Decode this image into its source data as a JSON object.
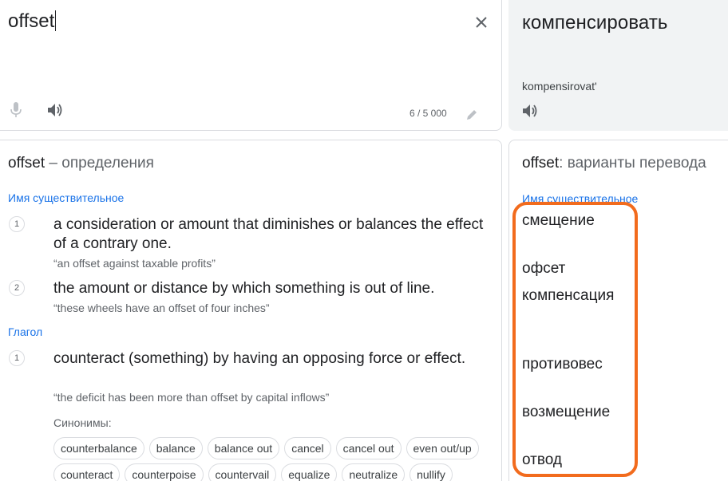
{
  "source": {
    "text": "offset",
    "char_count": "6 / 5 000"
  },
  "target": {
    "text": "компенсировать",
    "transliteration": "kompensirovat'"
  },
  "definitions": {
    "word": "offset",
    "title_suffix": " – определения",
    "noun_label": "Имя существительное",
    "verb_label": "Глагол",
    "noun_defs": [
      {
        "num": "1",
        "text": "a consideration or amount that diminishes or balances the effect of a contrary one.",
        "example": "“an offset against taxable profits”"
      },
      {
        "num": "2",
        "text": "the amount or distance by which something is out of line.",
        "example": "“these wheels have an offset of four inches”"
      }
    ],
    "verb_defs": [
      {
        "num": "1",
        "text": "counteract (something) by having an opposing force or effect.",
        "example": "“the deficit has been more than offset by capital inflows”"
      }
    ],
    "synonyms_label": "Синонимы:",
    "synonyms_row1": [
      "counterbalance",
      "balance",
      "balance out",
      "cancel",
      "cancel out",
      "even out/up"
    ],
    "synonyms_row2": [
      "counteract",
      "counterpoise",
      "countervail",
      "equalize",
      "neutralize",
      "nullify"
    ]
  },
  "variants": {
    "word": "offset",
    "title_suffix": ": варианты перевода",
    "pos_label": "Имя существительное",
    "items": [
      "смещение",
      "офсет",
      "компенсация",
      "противовес",
      "возмещение",
      "отвод"
    ]
  },
  "colors": {
    "accent": "#1a73e8",
    "highlight": "#f26b1d"
  },
  "icons": [
    "close-icon",
    "microphone-icon",
    "speaker-icon",
    "pencil-icon"
  ]
}
